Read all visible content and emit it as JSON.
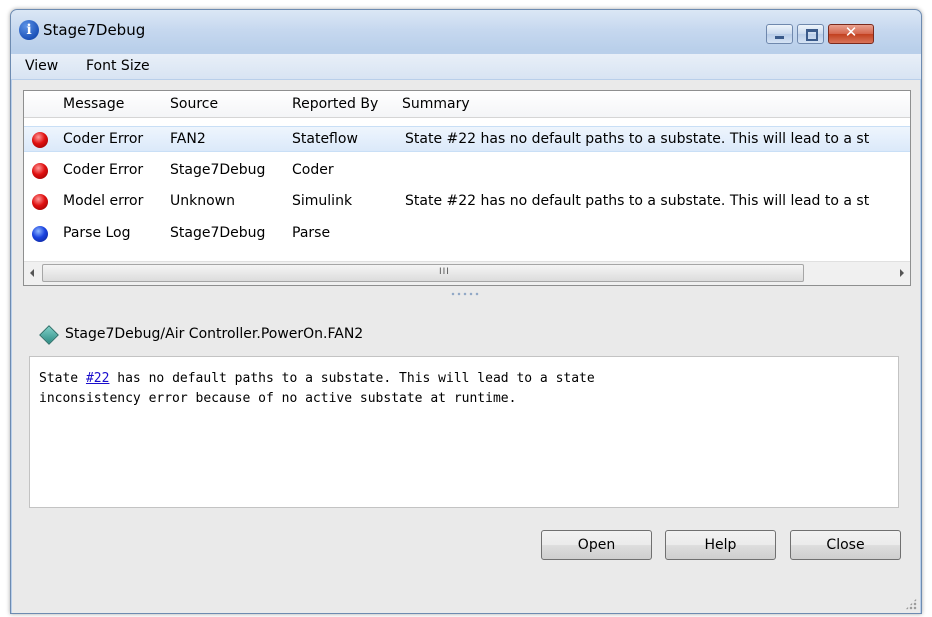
{
  "window": {
    "title": "Stage7Debug",
    "buttons": {
      "minimize": "minimize",
      "maximize": "maximize",
      "close_glyph": "✕"
    }
  },
  "menu": {
    "items": [
      "View",
      "Font Size"
    ]
  },
  "table": {
    "columns": [
      "Message",
      "Source",
      "Reported By",
      "Summary"
    ],
    "rows": [
      {
        "icon": "red-error-icon",
        "message": "Coder Error",
        "source": "FAN2",
        "reported_by": "Stateflow",
        "summary": "State #22 has no default paths to a substate. This will lead to a st",
        "selected": true
      },
      {
        "icon": "red-error-icon",
        "message": "Coder Error",
        "source": "Stage7Debug",
        "reported_by": "Coder",
        "summary": "",
        "selected": false
      },
      {
        "icon": "red-error-icon",
        "message": "Model error",
        "source": "Unknown",
        "reported_by": "Simulink",
        "summary": "State #22 has no default paths to a substate. This will lead to a st",
        "selected": false
      },
      {
        "icon": "blue-info-icon",
        "message": "Parse Log",
        "source": "Stage7Debug",
        "reported_by": "Parse",
        "summary": "",
        "selected": false
      }
    ],
    "scrollbar": {
      "grip": "III"
    }
  },
  "detail": {
    "path": "Stage7Debug/Air Controller.PowerOn.FAN2",
    "text_before_link": "State ",
    "link": "#22",
    "text_line1_after": " has no default paths to a substate. This will lead to a state",
    "text_line2": "inconsistency error because of no active substate at runtime."
  },
  "buttons": {
    "open": "Open",
    "help": "Help",
    "close": "Close"
  },
  "colors": {
    "error": "#e01010",
    "info": "#1a43e0",
    "link": "#1a0dcc",
    "selection": "#dbe9fa"
  }
}
